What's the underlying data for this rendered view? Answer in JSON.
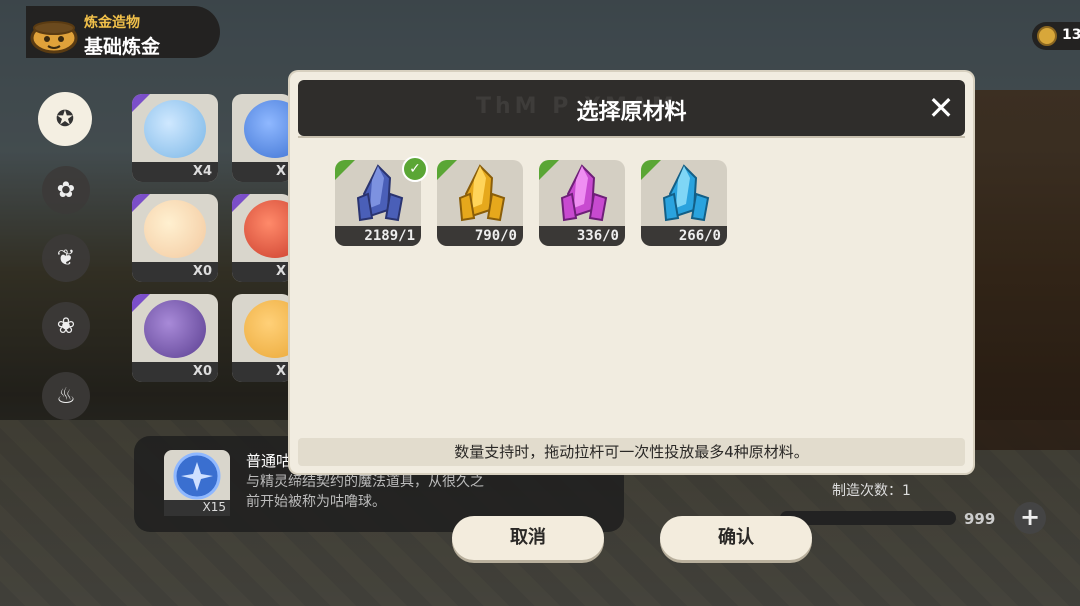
{
  "header": {
    "subtitle": "炼金造物",
    "title": "基础炼金"
  },
  "currency": {
    "value": "13",
    "icon": "coin-icon"
  },
  "sidebar": {
    "items": [
      {
        "icon": "star-badge-icon",
        "active": true
      },
      {
        "icon": "flower-icon",
        "active": false
      },
      {
        "icon": "leaf-icon",
        "active": false
      },
      {
        "icon": "petal-icon",
        "active": false
      },
      {
        "icon": "cauldron-icon",
        "active": false
      }
    ]
  },
  "background_items": [
    {
      "count": "X4",
      "color": "#7ab6e6"
    },
    {
      "count": "X",
      "color": "#3a6fd0"
    },
    {
      "count": "X0",
      "color": "#f3c9a0"
    },
    {
      "count": "X",
      "color": "#c83a2a"
    },
    {
      "count": "X0",
      "color": "#5a3e90"
    },
    {
      "count": "X",
      "color": "#e9a634"
    }
  ],
  "info_panel": {
    "name": "普通咕",
    "description": "与精灵缔结契约的魔法道具，从很久之前开始被称为咕噜球。",
    "count": "X15"
  },
  "crafting": {
    "label": "制造次数：1",
    "max": "999",
    "plus": "+"
  },
  "modal": {
    "title": "选择原材料",
    "ghost_text": "ThM P    XMAM",
    "close": "✕",
    "tip": "数量支持时，拖动拉杆可一次性投放最多4种原材料。",
    "materials": [
      {
        "count": "2189/1",
        "color": "#4a5fb8",
        "light": "#7d92e0",
        "selected": true
      },
      {
        "count": "790/0",
        "color": "#e6a81c",
        "light": "#ffd45a",
        "selected": false
      },
      {
        "count": "336/0",
        "color": "#c84ad0",
        "light": "#ef8ef2",
        "selected": false
      },
      {
        "count": "266/0",
        "color": "#2aa3de",
        "light": "#7fd6f6",
        "selected": false
      }
    ]
  },
  "buttons": {
    "cancel": "取消",
    "confirm": "确认"
  },
  "colors": {
    "accent_green": "#5aa635",
    "modal_bg": "#f1ece0",
    "bar_dark": "#2f2d2b"
  }
}
